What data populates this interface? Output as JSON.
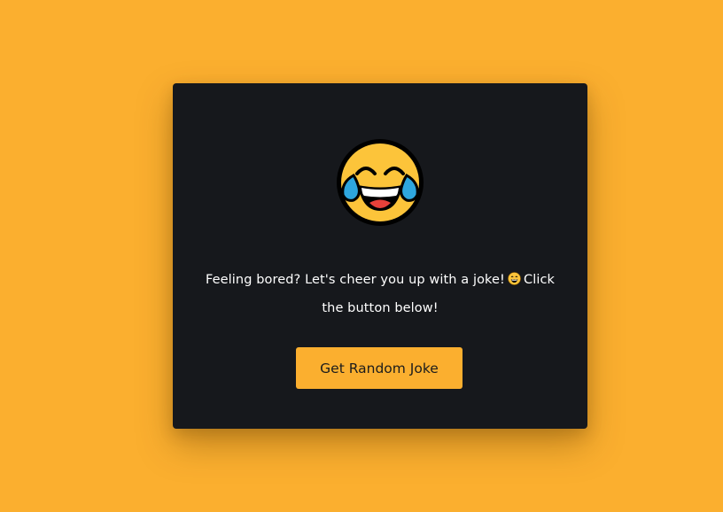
{
  "card": {
    "emoji_icon": "face-with-tears-of-joy-icon",
    "message_part1": "Feeling bored? Let's cheer you up with a joke!",
    "message_emoji_icon": "grinning-face-icon",
    "message_part2": "Click the button below!"
  },
  "button": {
    "label": "Get Random Joke"
  },
  "colors": {
    "background": "#fbaf2f",
    "card": "#16181c",
    "button": "#fbaf2f",
    "text": "#ffffff",
    "button_text": "#1c1c1c"
  }
}
